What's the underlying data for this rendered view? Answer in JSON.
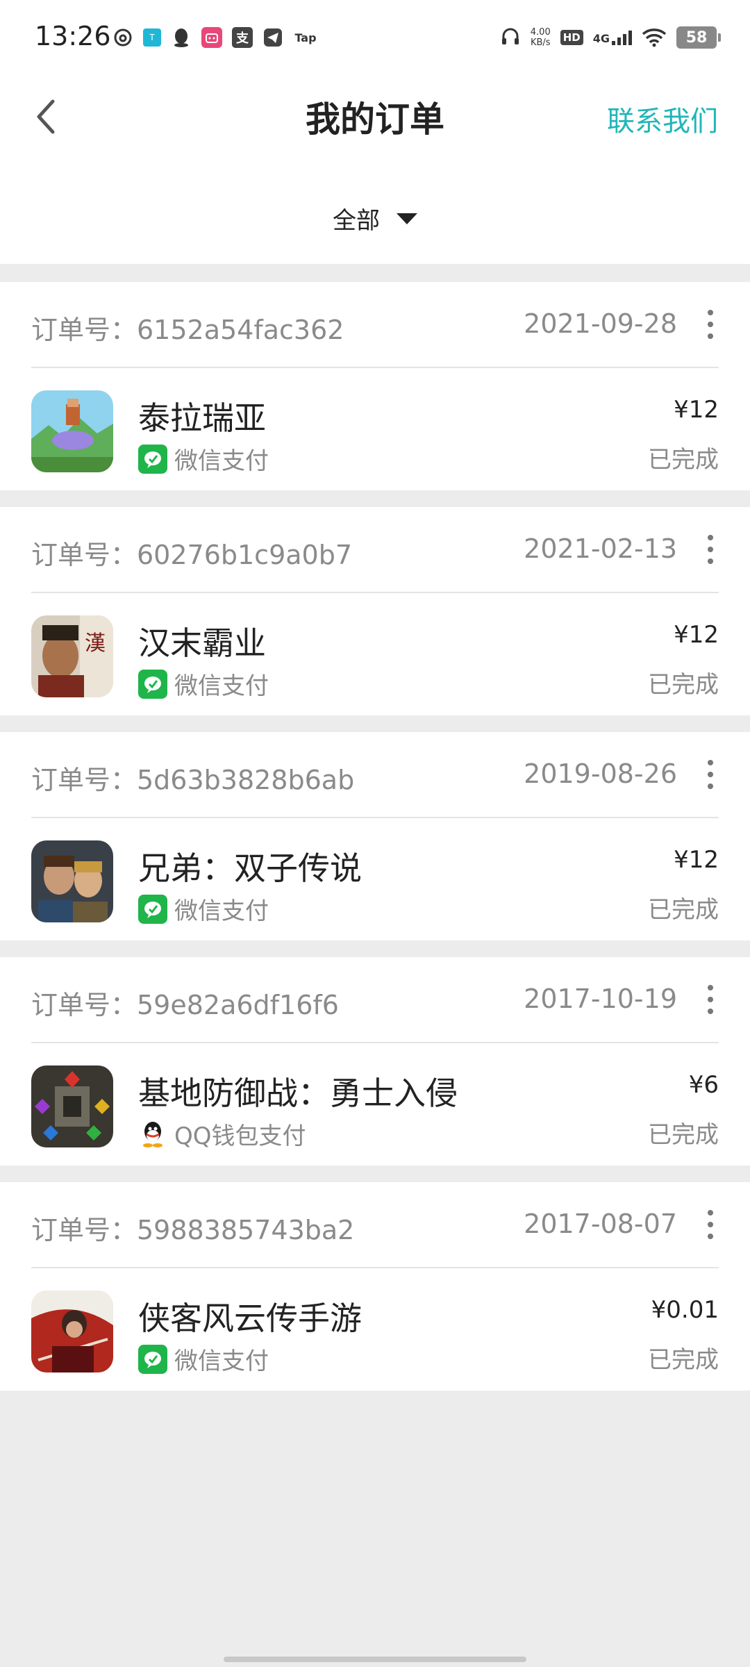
{
  "status_bar": {
    "time": "13:26",
    "net_speed_value": "4.00",
    "net_speed_unit": "KB/s",
    "hd": "HD",
    "network": "4G",
    "tap_label": "Tap",
    "alipay_char": "支",
    "battery": "58"
  },
  "header": {
    "title": "我的订单",
    "contact": "联系我们"
  },
  "filter": {
    "selected": "全部"
  },
  "colors": {
    "accent": "#21b6b8",
    "wechat_green": "#1fb54a",
    "background": "#ececec"
  },
  "orders": [
    {
      "order_label": "订单号：6152a54fac362",
      "date": "2021-09-28",
      "game": "泰拉瑞亚",
      "payment": "微信支付",
      "price": "¥12",
      "status": "已完成"
    },
    {
      "order_label": "订单号：60276b1c9a0b7",
      "date": "2021-02-13",
      "game": "汉末霸业",
      "payment": "微信支付",
      "price": "¥12",
      "status": "已完成"
    },
    {
      "order_label": "订单号：5d63b3828b6ab",
      "date": "2019-08-26",
      "game": "兄弟：双子传说",
      "payment": "微信支付",
      "price": "¥12",
      "status": "已完成"
    },
    {
      "order_label": "订单号：59e82a6df16f6",
      "date": "2017-10-19",
      "game": "基地防御战：勇士入侵",
      "payment": "QQ钱包支付",
      "price": "¥6",
      "status": "已完成"
    },
    {
      "order_label": "订单号：5988385743ba2",
      "date": "2017-08-07",
      "game": "侠客风云传手游",
      "payment": "微信支付",
      "price": "¥0.01",
      "status": "已完成"
    }
  ]
}
